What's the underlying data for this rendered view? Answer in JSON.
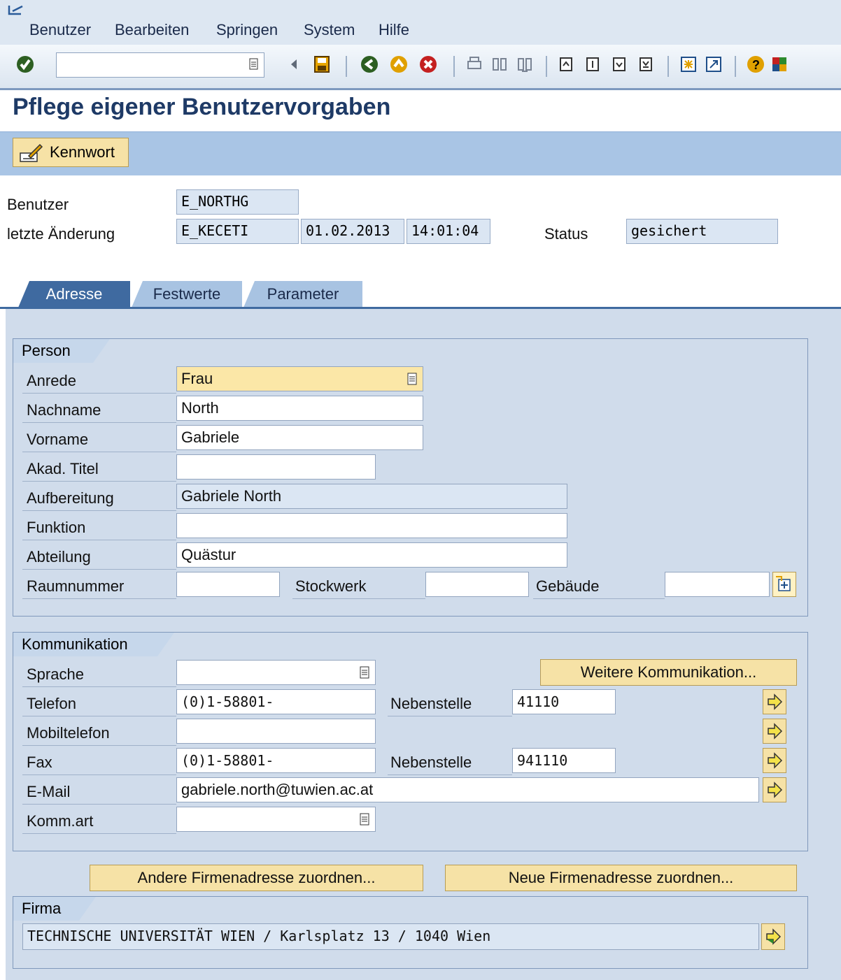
{
  "menu": {
    "items": [
      "Benutzer",
      "Bearbeiten",
      "Springen",
      "System",
      "Hilfe"
    ]
  },
  "toolbar": {
    "command_field_value": ""
  },
  "page": {
    "title": "Pflege eigener Benutzervorgaben"
  },
  "app_toolbar": {
    "kennwort_label": "Kennwort"
  },
  "header": {
    "benutzer_label": "Benutzer",
    "benutzer_value": "E_NORTHG",
    "letzte_label": "letzte Änderung",
    "letzte_user": "E_KECETI",
    "letzte_date": "01.02.2013",
    "letzte_time": "14:01:04",
    "status_label": "Status",
    "status_value": "gesichert"
  },
  "tabs": [
    "Adresse",
    "Festwerte",
    "Parameter"
  ],
  "person": {
    "title": "Person",
    "anrede_label": "Anrede",
    "anrede_value": "Frau",
    "nachname_label": "Nachname",
    "nachname_value": "North",
    "vorname_label": "Vorname",
    "vorname_value": "Gabriele",
    "titel_label": "Akad. Titel",
    "titel_value": "",
    "aufbereitung_label": "Aufbereitung",
    "aufbereitung_value": "Gabriele North",
    "funktion_label": "Funktion",
    "funktion_value": "",
    "abteilung_label": "Abteilung",
    "abteilung_value": "Quästur",
    "raum_label": "Raumnummer",
    "raum_value": "",
    "stockwerk_label": "Stockwerk",
    "stockwerk_value": "",
    "gebaeude_label": "Gebäude",
    "gebaeude_value": ""
  },
  "kommunikation": {
    "title": "Kommunikation",
    "sprache_label": "Sprache",
    "sprache_value": "",
    "weitere_button": "Weitere Kommunikation...",
    "telefon_label": "Telefon",
    "telefon_value": "(0)1-58801-",
    "neben1_label": "Nebenstelle",
    "neben1_value": "41110",
    "mobil_label": "Mobiltelefon",
    "mobil_value": "",
    "fax_label": "Fax",
    "fax_value": "(0)1-58801-",
    "neben2_label": "Nebenstelle",
    "neben2_value": "941110",
    "email_label": "E-Mail",
    "email_value": "gabriele.north@tuwien.ac.at",
    "kommart_label": "Komm.art",
    "kommart_value": ""
  },
  "buttons": {
    "andere": "Andere Firmenadresse zuordnen...",
    "neue": "Neue Firmenadresse zuordnen..."
  },
  "firma": {
    "title": "Firma",
    "value": "TECHNISCHE UNIVERSITÄT WIEN / Karlsplatz 13 / 1040 Wien"
  },
  "colors": {
    "accent": "#1e3a66",
    "tab_active": "#3f6aa0",
    "button_bg": "#f6e2a6",
    "required_field": "#fbe7a7"
  }
}
